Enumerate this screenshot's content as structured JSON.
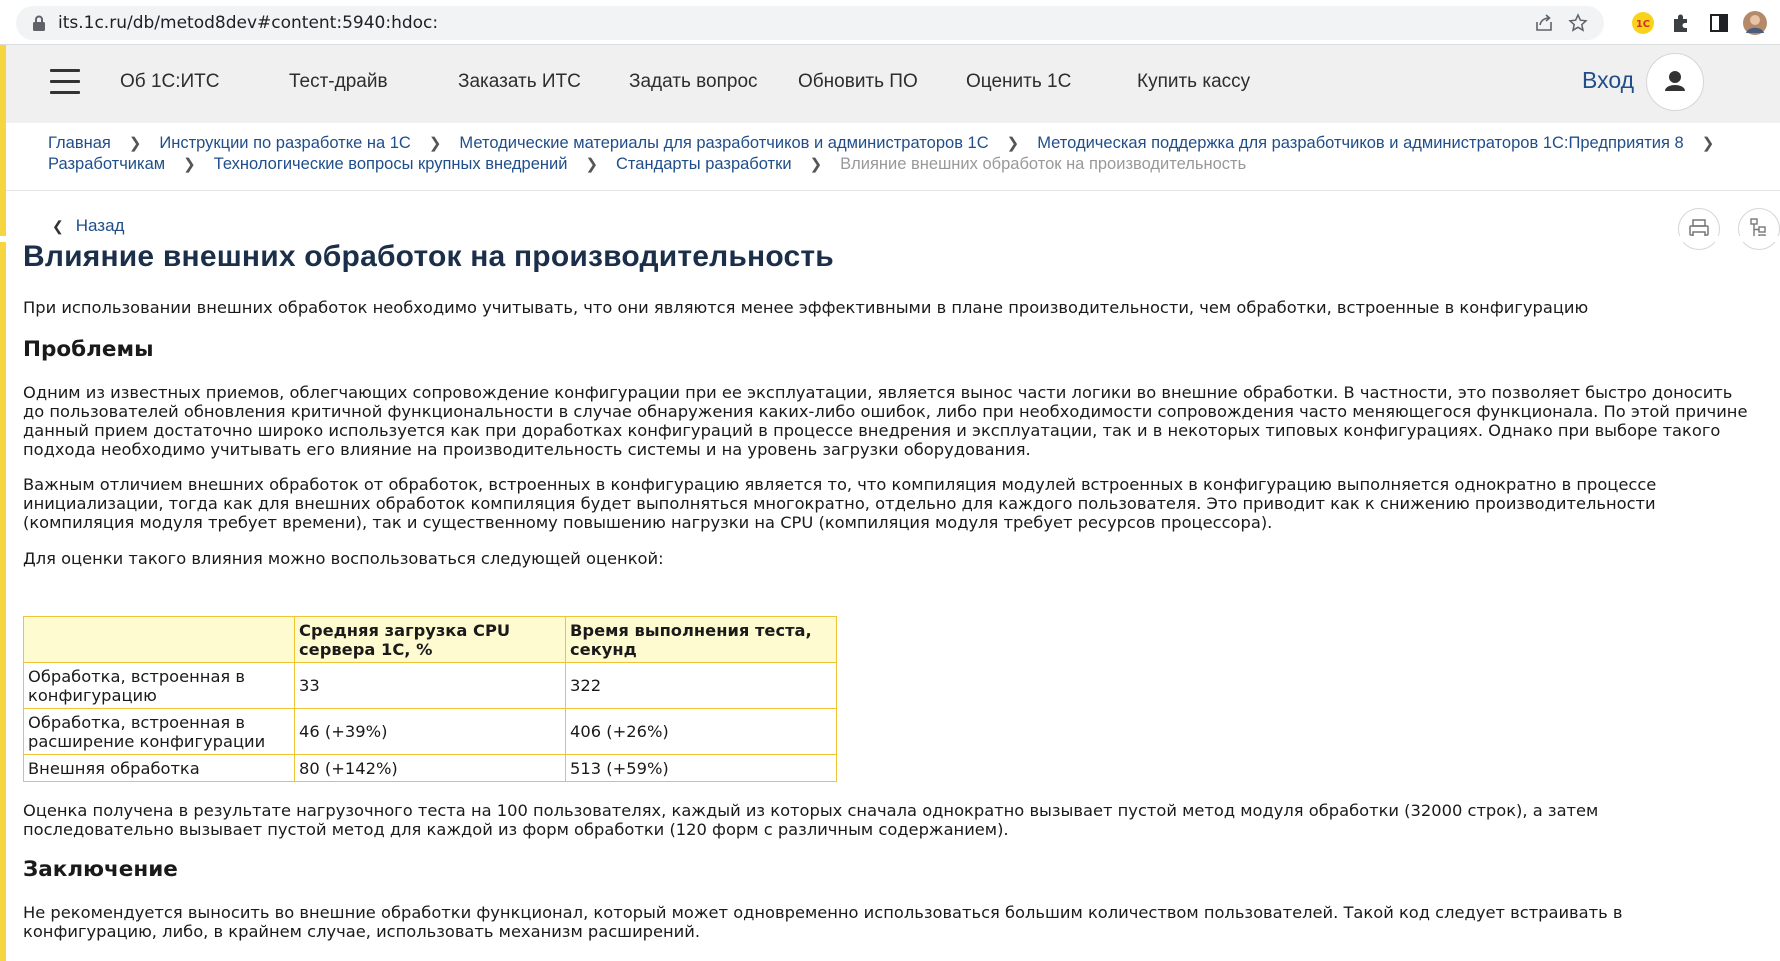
{
  "browser": {
    "url": "its.1c.ru/db/metod8dev#content:5940:hdoc:"
  },
  "header": {
    "nav": [
      "Об 1С:ИТС",
      "Тест-драйв",
      "Заказать ИТС",
      "Задать вопрос",
      "Обновить ПО",
      "Оценить 1С",
      "Купить кассу"
    ],
    "login": "Вход"
  },
  "breadcrumb": {
    "items": [
      "Главная",
      "Инструкции по разработке на 1С",
      "Методические материалы для разработчиков и администраторов 1С",
      "Методическая поддержка для разработчиков и администраторов 1С:Предприятия 8",
      "Разработчикам",
      "Технологические вопросы крупных внедрений",
      "Стандарты разработки"
    ],
    "current": "Влияние внешних обработок на производительность"
  },
  "back_label": "Назад",
  "article": {
    "title": "Влияние внешних обработок на производительность",
    "intro": "При использовании внешних обработок необходимо учитывать, что они являются менее эффективными в плане производительности, чем обработки, встроенные в конфигурацию",
    "section1_title": "Проблемы",
    "p1": "Одним из известных приемов, облегчающих сопровождение конфигурации при ее эксплуатации, является вынос части логики во внешние обработки. В частности, это позволяет быстро доносить до пользователей обновления критичной функциональности в случае обнаружения каких-либо ошибок, либо при необходимости сопровождения часто меняющегося функционала. По этой причине данный прием достаточно широко используется как при доработках конфигураций в процессе внедрения и эксплуатации, так и в некоторых типовых конфигурациях. Однако при выборе такого подхода необходимо учитывать его влияние на производительность системы и на уровень загрузки оборудования.",
    "p2": "Важным отличием внешних обработок от обработок, встроенных в конфигурацию является то, что компиляция модулей встроенных в конфигурацию выполняется однократно в процессе инициализации, тогда как для внешних обработок компиляция будет выполняться многократно, отдельно для каждого пользователя. Это приводит как к снижению производительности (компиляция модуля требует времени), так и существенному повышению нагрузки на CPU (компиляция модуля требует ресурсов процессора).",
    "p3": "Для оценки такого влияния можно воспользоваться следующей оценкой:",
    "table": {
      "headers": [
        "",
        "Средняя загрузка CPU сервера 1С, %",
        "Время выполнения теста, секунд"
      ],
      "rows": [
        [
          "Обработка, встроенная в конфигурацию",
          "33",
          "322"
        ],
        [
          "Обработка, встроенная в расширение конфигурации",
          "46 (+39%)",
          "406 (+26%)"
        ],
        [
          "Внешняя обработка",
          "80 (+142%)",
          "513 (+59%)"
        ]
      ]
    },
    "p4": "Оценка получена в результате нагрузочного теста на 100 пользователях, каждый из которых сначала однократно вызывает пустой метод модуля обработки (32000 строк), а затем последовательно вызывает пустой метод для каждой из форм обработки (120 форм с различным содержанием).",
    "section2_title": "Заключение",
    "p5": "Не рекомендуется выносить во внешние обработки функционал, который может одновременно использоваться большим количеством пользователей. Такой код следует встраивать в конфигурацию, либо, в крайнем случае, использовать механизм расширений."
  }
}
